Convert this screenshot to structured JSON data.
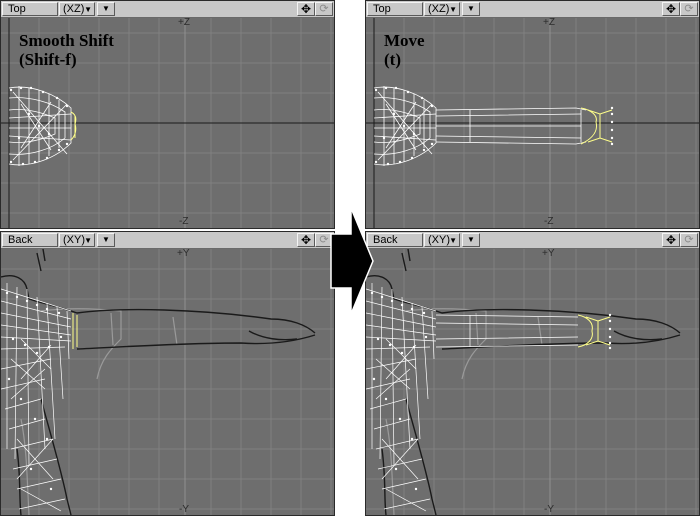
{
  "left_panel": {
    "tool_name": "Smooth Shift",
    "shortcut": "(Shift-f)",
    "top_view": {
      "view_name": "Top",
      "axis": "(XZ)",
      "axis_pos": "+Z",
      "axis_neg": "-Z"
    },
    "back_view": {
      "view_name": "Back",
      "axis": "(XY)",
      "axis_pos": "+Y",
      "axis_neg": "-Y"
    }
  },
  "right_panel": {
    "tool_name": "Move",
    "shortcut": "(t)",
    "top_view": {
      "view_name": "Top",
      "axis": "(XZ)",
      "axis_pos": "+Z",
      "axis_neg": "-Z"
    },
    "back_view": {
      "view_name": "Back",
      "axis": "(XY)",
      "axis_pos": "+Y",
      "axis_neg": "-Y"
    }
  },
  "icons": {
    "menu_arrow": "triangle-down-icon",
    "pan": "four-way-arrows-icon",
    "rotate": "rotate-icon",
    "transition": "right-arrow-icon"
  },
  "colors": {
    "viewport_bg": "#6e6e6e",
    "grid": "#828282",
    "mesh": "#ffffff",
    "selection": "#ffff8a",
    "header": "#c8c8c8"
  }
}
